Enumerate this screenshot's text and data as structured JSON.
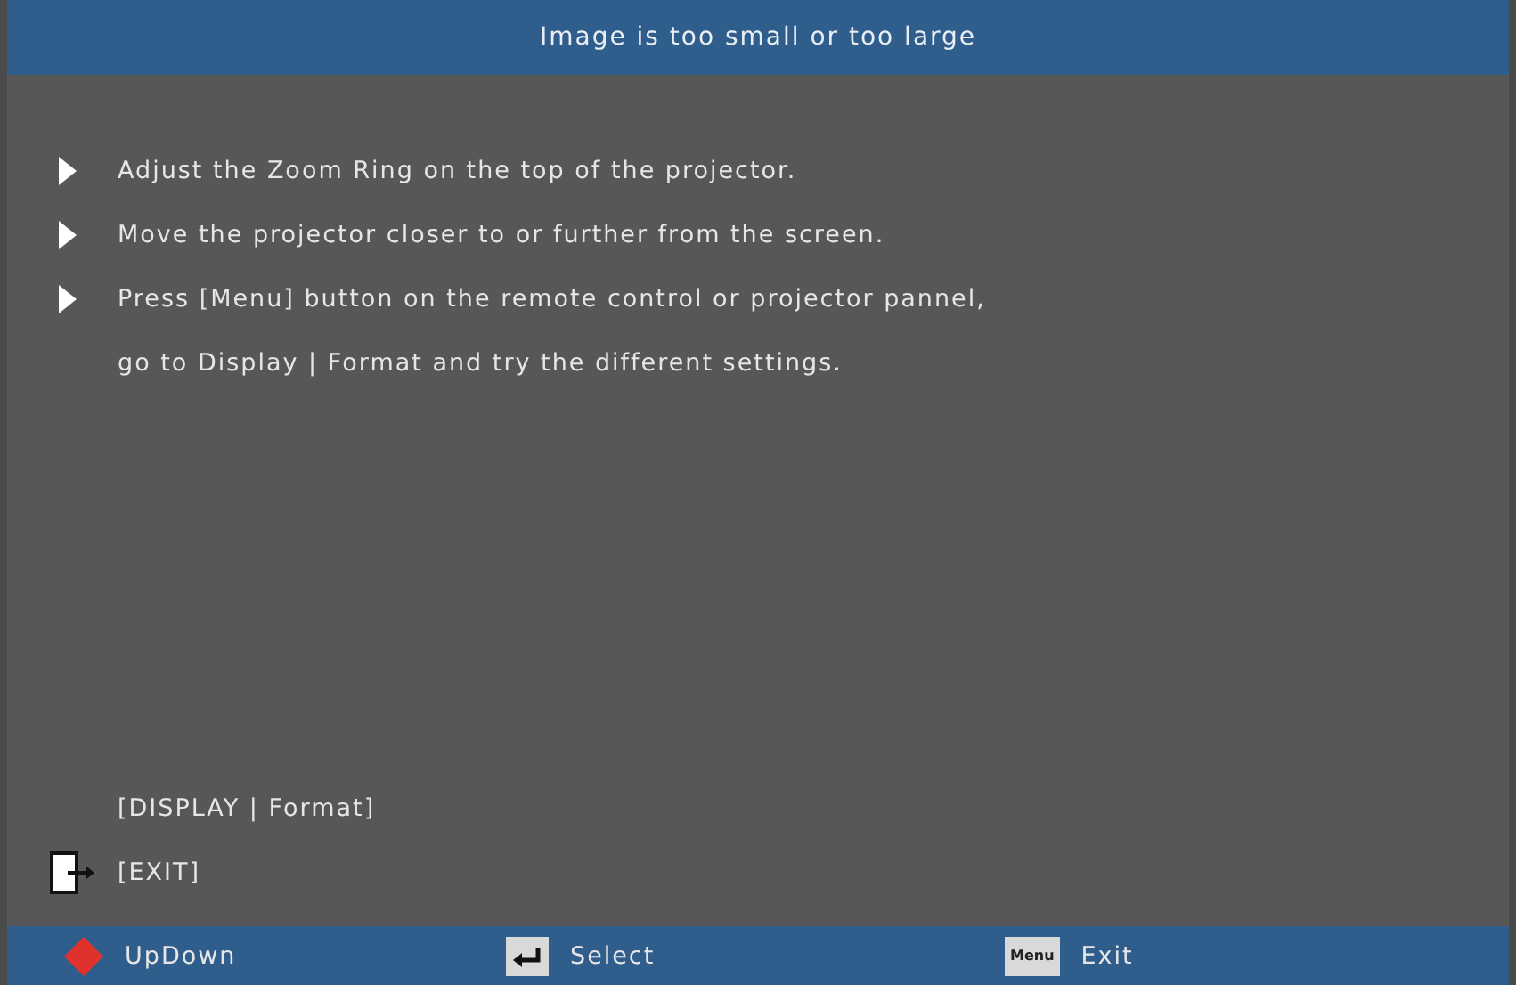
{
  "title": "Image is too small or too large",
  "tips": [
    {
      "kind": "bullet",
      "text": "Adjust the Zoom Ring on the top of the projector."
    },
    {
      "kind": "bullet",
      "text": "Move the projector closer to or further from the screen."
    },
    {
      "kind": "bullet",
      "text": "Press [Menu] button on the remote control or projector pannel,"
    },
    {
      "kind": "continuation",
      "text": "go to Display  |  Format and try the different settings."
    }
  ],
  "shortcut": "[DISPLAY  |  Format]",
  "exit": "[EXIT]",
  "footer": [
    {
      "kind": "updown",
      "label": "UpDown"
    },
    {
      "kind": "enter",
      "label": "Select"
    },
    {
      "kind": "menu",
      "key": "Menu",
      "label": "Exit"
    }
  ]
}
